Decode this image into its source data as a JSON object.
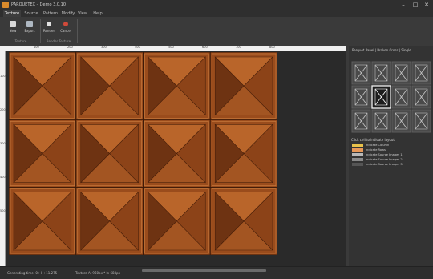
{
  "window": {
    "title": "PARQUETEX – Demo 3.0.10",
    "minimize": "–",
    "maximize": "□",
    "close": "✕"
  },
  "menu": {
    "tabs": [
      "Texture",
      "Source",
      "Pattern",
      "Modify",
      "View",
      "Help"
    ],
    "active": "Texture"
  },
  "ribbon": {
    "texture_group": {
      "label": "Texture",
      "buttons": [
        {
          "label": "New",
          "icon": "new-file-icon"
        },
        {
          "label": "Export",
          "icon": "export-icon"
        }
      ]
    },
    "render_group": {
      "label": "Render Texture",
      "buttons": [
        {
          "label": "Render",
          "icon": "render-icon"
        },
        {
          "label": "Cancel",
          "icon": "cancel-icon"
        }
      ]
    }
  },
  "ruler": {
    "top": [
      "100",
      "200",
      "300",
      "400",
      "500",
      "600",
      "700",
      "800"
    ],
    "left": [
      "100",
      "200",
      "300",
      "400",
      "500"
    ]
  },
  "panel": {
    "title": "Parquet Panel | Broken Cross | Single",
    "hint": "Click cell to indicate layout:",
    "legend": [
      {
        "label": "Indicate Column",
        "color": "#e8c24a"
      },
      {
        "label": "Indicate Rows",
        "color": "#e89858"
      },
      {
        "label": "Indicate Source Images 1",
        "color": "#b8b8b8"
      },
      {
        "label": "Indicate Source Images 2",
        "color": "#8a8a8a"
      },
      {
        "label": "Indicate Source Images 3",
        "color": "#555555"
      }
    ]
  },
  "status": {
    "left": "Generating time: 0 : 0 : 11.275",
    "right": "Texture At 960px * In 683px"
  },
  "colors": {
    "accent": "#d98a2c",
    "wood_dark": "#6e3312",
    "wood_light": "#b9652a"
  }
}
